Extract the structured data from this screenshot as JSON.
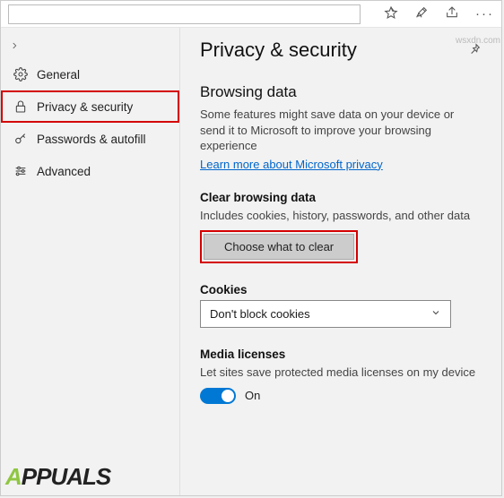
{
  "titlebar": {
    "favorites_icon": "favorites-star",
    "pen_icon": "reading-list",
    "share_icon": "share",
    "more_icon": "more"
  },
  "sidebar": {
    "back_label": "Back",
    "items": [
      {
        "icon": "gear",
        "label": "General"
      },
      {
        "icon": "lock",
        "label": "Privacy & security"
      },
      {
        "icon": "key",
        "label": "Passwords & autofill"
      },
      {
        "icon": "sliders",
        "label": "Advanced"
      }
    ]
  },
  "main": {
    "title": "Privacy & security",
    "browsing_data": {
      "heading": "Browsing data",
      "desc": "Some features might save data on your device or send it to Microsoft to improve your browsing experience",
      "link": "Learn more about Microsoft privacy"
    },
    "clear": {
      "heading": "Clear browsing data",
      "desc": "Includes cookies, history, passwords, and other data",
      "button": "Choose what to clear"
    },
    "cookies": {
      "heading": "Cookies",
      "value": "Don't block cookies"
    },
    "media": {
      "heading": "Media licenses",
      "desc": "Let sites save protected media licenses on my device",
      "toggle_state": "On"
    }
  },
  "watermark": {
    "brand_a": "A",
    "brand_rest": "PPUALS"
  },
  "source": "wsxdn.com"
}
